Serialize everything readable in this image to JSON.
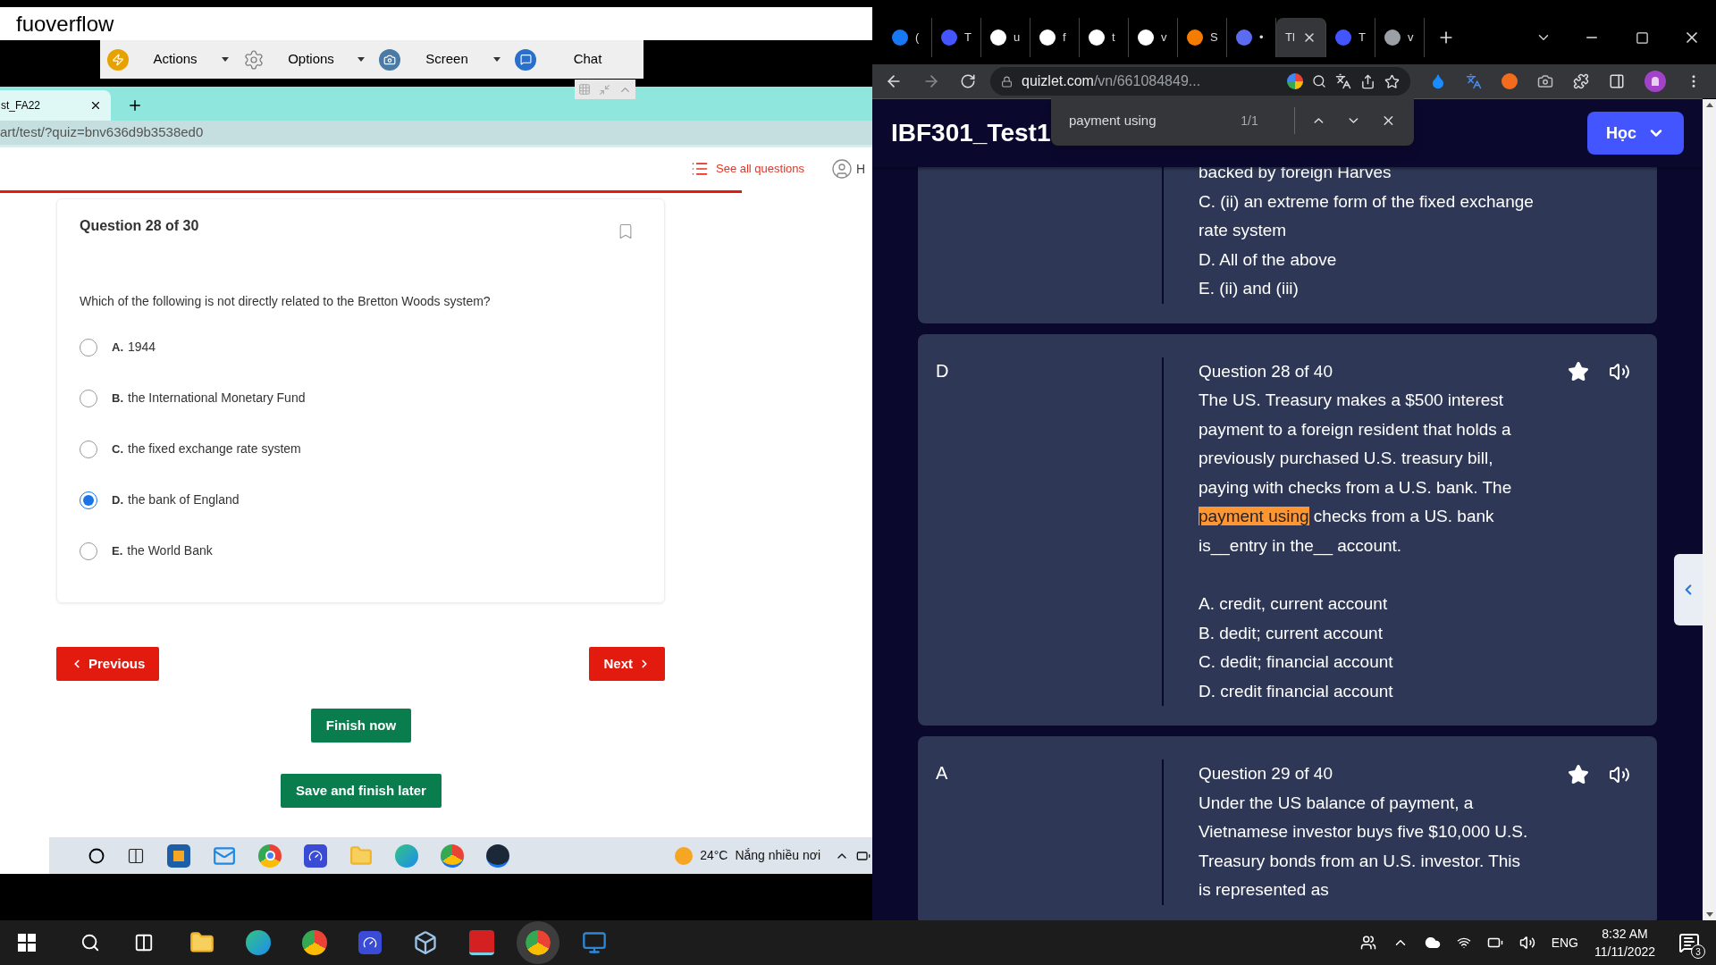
{
  "remote_window": {
    "title": "fuoverflow",
    "toolbar": [
      {
        "label": "Actions",
        "kind": "menu"
      },
      {
        "label": "Options",
        "kind": "menu"
      },
      {
        "label": "Screen",
        "kind": "menu"
      },
      {
        "label": "Chat",
        "kind": "button"
      }
    ]
  },
  "inner_browser": {
    "tab": {
      "label": "st_FA22"
    },
    "address": "art/test/?quiz=bnv636d9b3538ed0"
  },
  "quiz": {
    "see_all": "See all questions",
    "user": "H",
    "progress": {
      "level": 0.85
    },
    "question": {
      "title": "Question 28 of 30",
      "bookmarked": false,
      "text": "Which of the following is not directly related to the Bretton Woods system?",
      "options": [
        {
          "letter": "A.",
          "text": "1944",
          "selected": false
        },
        {
          "letter": "B.",
          "text": "the International Monetary Fund",
          "selected": false
        },
        {
          "letter": "C.",
          "text": "the fixed exchange rate system",
          "selected": false
        },
        {
          "letter": "D.",
          "text": "the bank of England",
          "selected": true
        },
        {
          "letter": "E.",
          "text": "the World Bank",
          "selected": false
        }
      ]
    },
    "buttons": {
      "previous": "Previous",
      "next": "Next",
      "finish": "Finish now",
      "save": "Save and finish later"
    }
  },
  "inner_taskbar": {
    "temperature": "24°C",
    "weather": "Nắng nhiều nơi"
  },
  "chrome": {
    "tabs": [
      {
        "label": "(",
        "color": "#1877f2",
        "selected": false
      },
      {
        "label": "T",
        "color": "#4255ff",
        "selected": false
      },
      {
        "label": "u",
        "color": "#ffffff",
        "selected": false
      },
      {
        "label": "f",
        "color": "#ffffff",
        "selected": false
      },
      {
        "label": "t",
        "color": "#ffffff",
        "selected": false
      },
      {
        "label": "v",
        "color": "#ffffff",
        "selected": false
      },
      {
        "label": "S",
        "color": "#f57c00",
        "selected": false
      },
      {
        "label": "•",
        "color": "#5b6cf0",
        "selected": false
      },
      {
        "label": "Tl",
        "selected": true
      },
      {
        "label": "T",
        "color": "#4255ff",
        "selected": false
      },
      {
        "label": "v",
        "color": "#9aa0a6",
        "selected": false
      }
    ],
    "address": {
      "host": "quizlet.com",
      "path": "/vn/661084849..."
    },
    "find": {
      "query": "payment using",
      "count": "1/1"
    },
    "page": {
      "title": "IBF301_Test1",
      "menu": "Học",
      "cards": [
        {
          "lines": [
            "backed by foreign Harves",
            "C. (ii) an extreme form of the fixed exchange rate system",
            "D. All of the above",
            "E. (ii) and (iii)"
          ]
        },
        {
          "answer": "D",
          "heading": "Question 28 of 40",
          "starred": true,
          "text_before": "The US. Treasury makes a $500 interest payment to a foreign resident that holds a previously purchased U.S. treasury bill, paying with checks from a U.S. bank. The",
          "highlight": "payment using",
          "text_after": "checks from a US. bank is__entry in the__ account.",
          "options": [
            "A. credit, current account",
            "B. dedit; current account",
            "C. dedit; financial account",
            "D. credit financial account"
          ]
        },
        {
          "answer": "A",
          "heading": "Question 29 of 40",
          "starred": true,
          "text_before": "Under the US balance of payment, a Vietnamese investor buys five $10,000 U.S. Treasury bonds from an U.S. investor. This is represented as"
        }
      ]
    }
  },
  "taskbar": {
    "language": "ENG",
    "time": "8:32 AM",
    "date": "11/11/2022",
    "notifications": "3"
  }
}
